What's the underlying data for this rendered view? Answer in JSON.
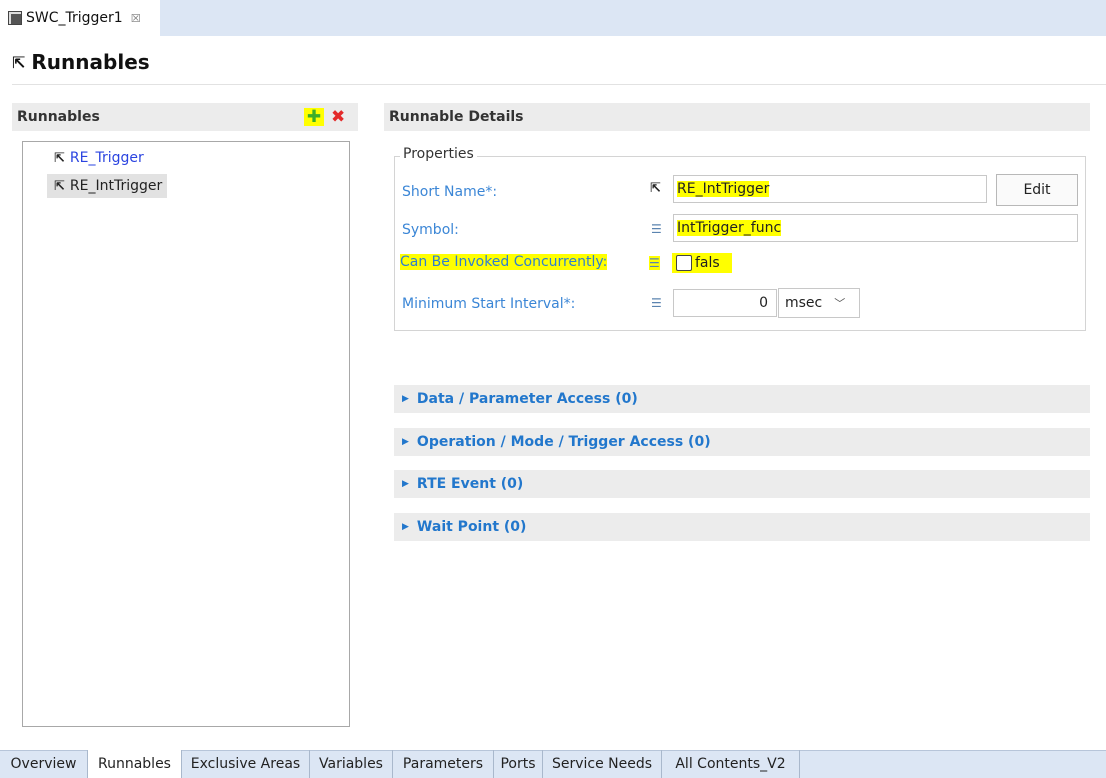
{
  "editor_tab": {
    "title": "SWC_Trigger1",
    "close_glyph": "☒"
  },
  "page": {
    "title": "Runnables",
    "icon": "runnable-icon"
  },
  "runnables_panel": {
    "header": "Runnables",
    "add_icon": "add-icon",
    "delete_icon": "delete-icon",
    "items": [
      {
        "label": "RE_Trigger",
        "selected": false
      },
      {
        "label": "RE_IntTrigger",
        "selected": true
      }
    ]
  },
  "details": {
    "header": "Runnable Details",
    "group_title": "Properties",
    "short_name": {
      "label": "Short Name*:",
      "value": "RE_IntTrigger",
      "edit_label": "Edit"
    },
    "symbol": {
      "label": "Symbol:",
      "value": "IntTrigger_func"
    },
    "concurrent": {
      "label": "Can Be Invoked Concurrently:",
      "value": "fals",
      "checked": false
    },
    "min_interval": {
      "label": "Minimum Start Interval*:",
      "value": "0",
      "unit": "msec"
    }
  },
  "sections": [
    "Data / Parameter Access (0)",
    "Operation / Mode / Trigger Access (0)",
    "RTE Event (0)",
    "Wait Point (0)"
  ],
  "bottom_tabs": [
    "Overview",
    "Runnables",
    "Exclusive Areas",
    "Variables",
    "Parameters",
    "Ports",
    "Service Needs",
    "All Contents_V2"
  ],
  "active_bottom_tab": "Runnables",
  "colors": {
    "highlight": "#ffff00",
    "link": "#2b44e0",
    "field_label": "#3b86d6",
    "section_text": "#2277cc",
    "tab_strip": "#dce6f4"
  }
}
